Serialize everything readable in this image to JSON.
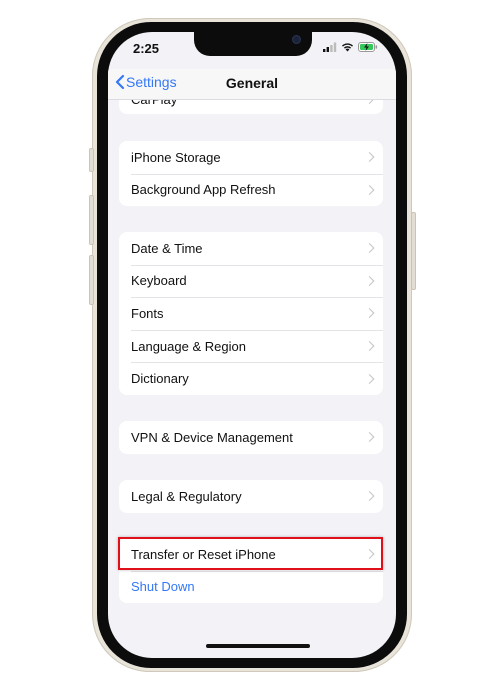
{
  "status_bar": {
    "time": "2:25",
    "icons": [
      "cellular-signal-icon",
      "wifi-icon",
      "battery-charging-icon"
    ]
  },
  "nav_bar": {
    "back_label": "Settings",
    "title": "General"
  },
  "groups": [
    {
      "items": [
        {
          "label": "CarPlay",
          "chevron": true
        }
      ]
    },
    {
      "items": [
        {
          "label": "iPhone Storage",
          "chevron": true
        },
        {
          "label": "Background App Refresh",
          "chevron": true
        }
      ]
    },
    {
      "items": [
        {
          "label": "Date & Time",
          "chevron": true
        },
        {
          "label": "Keyboard",
          "chevron": true
        },
        {
          "label": "Fonts",
          "chevron": true
        },
        {
          "label": "Language & Region",
          "chevron": true
        },
        {
          "label": "Dictionary",
          "chevron": true
        }
      ]
    },
    {
      "items": [
        {
          "label": "VPN & Device Management",
          "chevron": true
        }
      ]
    },
    {
      "items": [
        {
          "label": "Legal & Regulatory",
          "chevron": true
        }
      ]
    },
    {
      "items": [
        {
          "label": "Transfer or Reset iPhone",
          "chevron": true,
          "highlighted": true
        },
        {
          "label": "Shut Down",
          "chevron": false,
          "style": "link"
        }
      ]
    }
  ],
  "colors": {
    "accent": "#3478f6",
    "highlight_box": "#e0101a",
    "background": "#f2f2f7"
  }
}
